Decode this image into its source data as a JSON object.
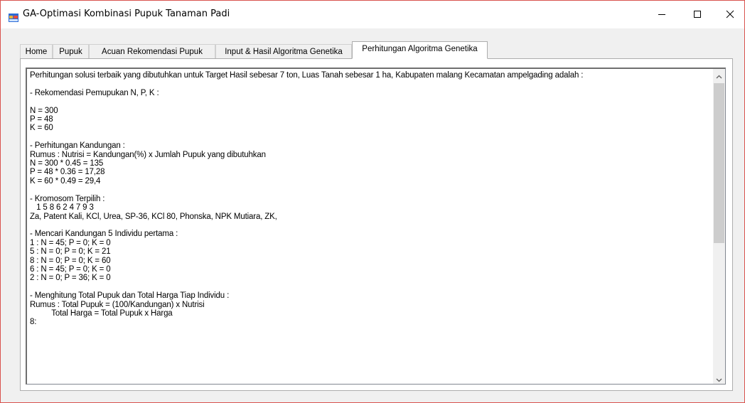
{
  "window": {
    "title": "GA-Optimasi Kombinasi Pupuk Tanaman Padi",
    "app_icon": "windows-form-icon",
    "controls": {
      "minimize": "minimize-icon",
      "maximize": "maximize-icon",
      "close": "close-icon"
    }
  },
  "tabs": [
    {
      "label": "Home",
      "active": false
    },
    {
      "label": "Pupuk",
      "active": false
    },
    {
      "label": "Acuan Rekomendasi Pupuk",
      "active": false
    },
    {
      "label": "Input & Hasil Algoritma Genetika",
      "active": false
    },
    {
      "label": "Perhitungan Algoritma Genetika",
      "active": true
    }
  ],
  "output": {
    "lines": [
      "Perhitungan solusi terbaik yang dibutuhkan untuk Target Hasil sebesar 7 ton, Luas Tanah sebesar 1 ha, Kabupaten malang Kecamatan ampelgading adalah :",
      "",
      "- Rekomendasi Pemupukan N, P, K :",
      "",
      "N = 300",
      "P = 48",
      "K = 60",
      "",
      "- Perhitungan Kandungan :",
      "Rumus : Nutrisi = Kandungan(%) x Jumlah Pupuk yang dibutuhkan",
      "N = 300 * 0.45 = 135",
      "P = 48 * 0.36 = 17,28",
      "K = 60 * 0.49 = 29,4",
      "",
      "- Kromosom Terpilih :",
      "   1 5 8 6 2 4 7 9 3",
      "Za, Patent Kali, KCl, Urea, SP-36, KCl 80, Phonska, NPK Mutiara, ZK,",
      "",
      "- Mencari Kandungan 5 Individu pertama :",
      "1 : N = 45; P = 0; K = 0",
      "5 : N = 0; P = 0; K = 21",
      "8 : N = 0; P = 0; K = 60",
      "6 : N = 45; P = 0; K = 0",
      "2 : N = 0; P = 36; K = 0",
      "",
      "- Menghitung Total Pupuk dan Total Harga Tiap Individu :",
      "Rumus : Total Pupuk = (100/Kandungan) x Nutrisi",
      "          Total Harga = Total Pupuk x Harga",
      "8:"
    ]
  },
  "scrollbar": {
    "up_icon": "scroll-up-arrow-icon",
    "down_icon": "scroll-down-arrow-icon",
    "position_fraction": 0.0,
    "visible_fraction": 0.55
  },
  "colors": {
    "window_border": "#d9534f",
    "chrome_bg": "#f0f0f0",
    "content_bg": "#ffffff",
    "scroll_thumb": "#cdcdcd"
  }
}
